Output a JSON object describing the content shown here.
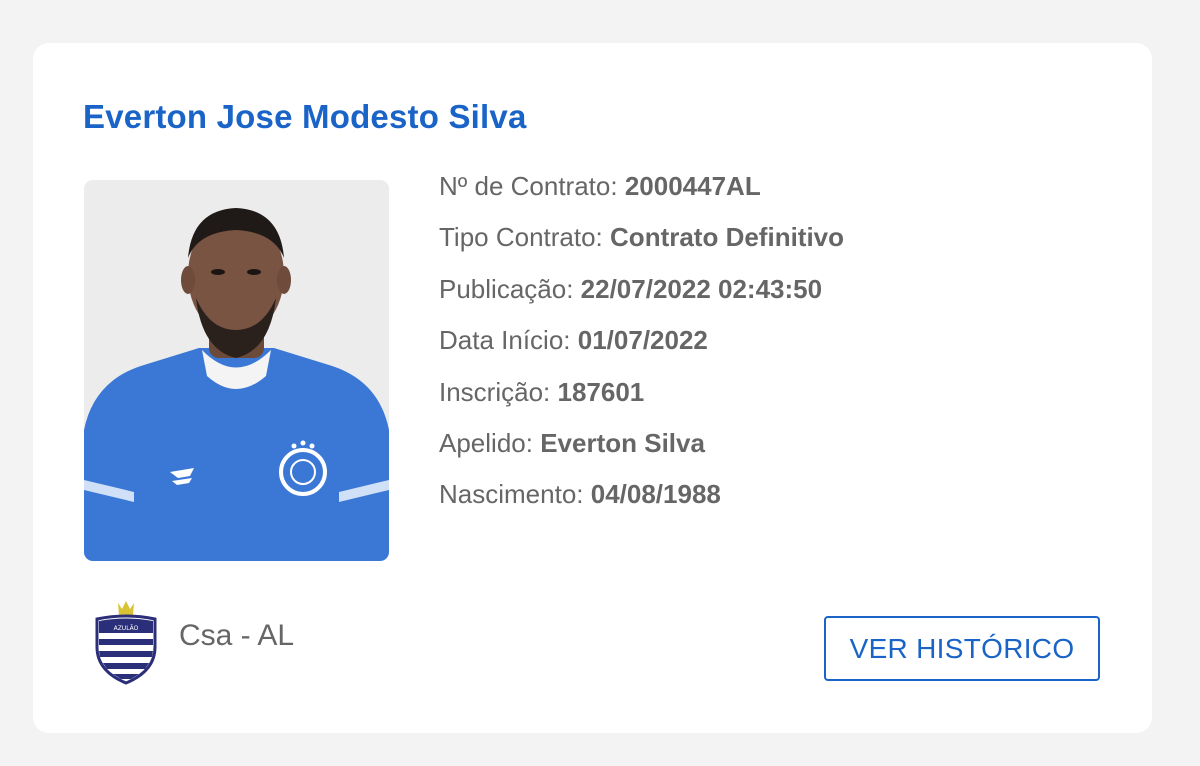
{
  "player": {
    "name": "Everton Jose Modesto Silva",
    "photo_alt": "Everton Jose Modesto Silva"
  },
  "details": [
    {
      "label": "Nº de Contrato:",
      "value": "2000447AL"
    },
    {
      "label": "Tipo Contrato:",
      "value": "Contrato Definitivo"
    },
    {
      "label": "Publicação:",
      "value": "22/07/2022 02:43:50"
    },
    {
      "label": "Data Início:",
      "value": "01/07/2022"
    },
    {
      "label": "Inscrição:",
      "value": "187601"
    },
    {
      "label": "Apelido:",
      "value": "Everton Silva"
    },
    {
      "label": "Nascimento:",
      "value": "04/08/1988"
    }
  ],
  "club": {
    "name": "Csa - AL",
    "crest_icon": "csa-crest-icon",
    "crest_text": "AZULÃO"
  },
  "actions": {
    "history_label": "VER HISTÓRICO"
  },
  "colors": {
    "accent": "#1a64c8",
    "text": "#666666",
    "card": "#ffffff",
    "background": "#f3f3f3",
    "crest_navy": "#2b2f7a",
    "crest_gold": "#d9c233"
  }
}
